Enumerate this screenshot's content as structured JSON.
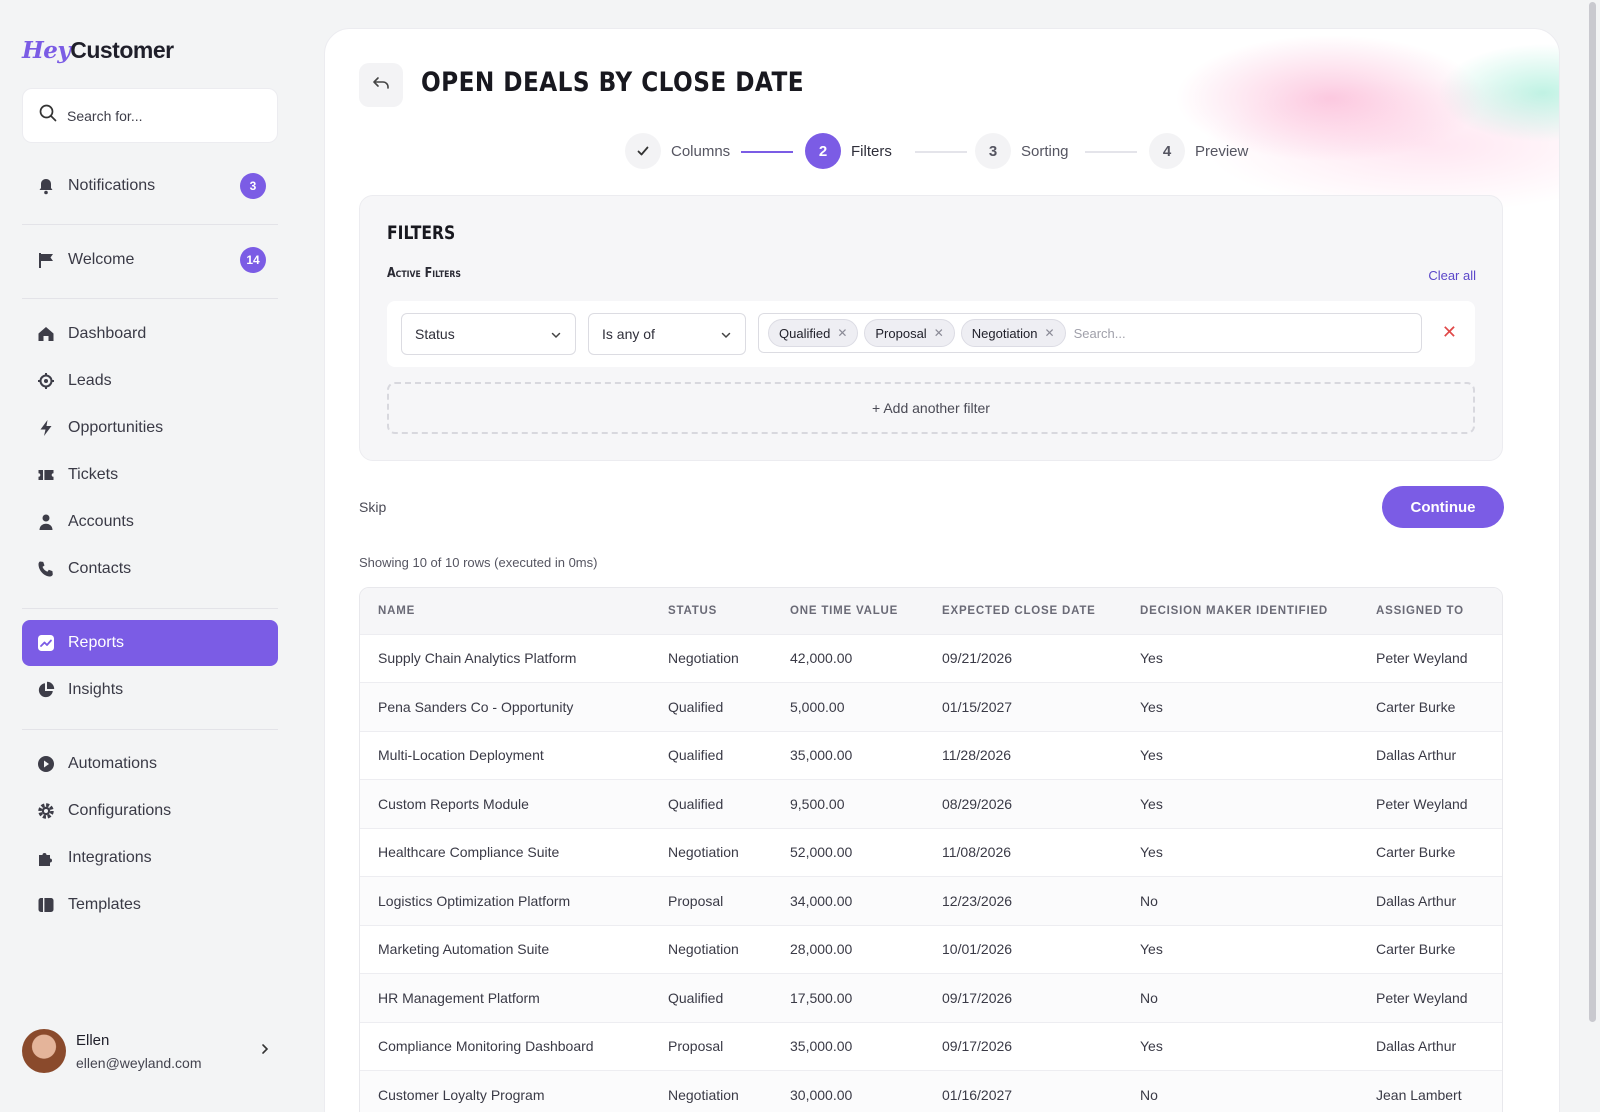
{
  "brand": {
    "prefix": "Hey",
    "suffix": "Customer"
  },
  "search": {
    "placeholder": "Search for..."
  },
  "sidebar": {
    "notifications": {
      "label": "Notifications",
      "badge": "3"
    },
    "welcome": {
      "label": "Welcome",
      "badge": "14"
    },
    "items": [
      {
        "label": "Dashboard",
        "icon": "home-icon"
      },
      {
        "label": "Leads",
        "icon": "target-icon"
      },
      {
        "label": "Opportunities",
        "icon": "bolt-icon"
      },
      {
        "label": "Tickets",
        "icon": "ticket-icon"
      },
      {
        "label": "Accounts",
        "icon": "person-icon"
      },
      {
        "label": "Contacts",
        "icon": "phone-icon"
      },
      {
        "label": "Reports",
        "icon": "chart-icon"
      },
      {
        "label": "Insights",
        "icon": "pie-icon"
      },
      {
        "label": "Automations",
        "icon": "play-icon"
      },
      {
        "label": "Configurations",
        "icon": "gear-icon"
      },
      {
        "label": "Integrations",
        "icon": "puzzle-icon"
      },
      {
        "label": "Templates",
        "icon": "template-icon"
      }
    ],
    "active": "Reports"
  },
  "user": {
    "name": "Ellen",
    "email": "ellen@weyland.com"
  },
  "page": {
    "title": "Open Deals by Close Date"
  },
  "stepper": {
    "steps": [
      {
        "number": "1",
        "label": "Columns",
        "state": "done"
      },
      {
        "number": "2",
        "label": "Filters",
        "state": "current"
      },
      {
        "number": "3",
        "label": "Sorting",
        "state": "upcoming"
      },
      {
        "number": "4",
        "label": "Preview",
        "state": "upcoming"
      }
    ]
  },
  "filters": {
    "title": "FILTERS",
    "active_label": "Active Filters",
    "clear_all": "Clear all",
    "field": "Status",
    "operator": "Is any of",
    "tags": [
      "Qualified",
      "Proposal",
      "Negotiation"
    ],
    "tag_search_placeholder": "Search...",
    "add_filter": "+ Add another filter"
  },
  "actions": {
    "skip": "Skip",
    "continue": "Continue"
  },
  "results": {
    "summary": "Showing 10 of 10 rows (executed in 0ms)"
  },
  "table": {
    "columns": [
      "NAME",
      "STATUS",
      "ONE TIME VALUE",
      "EXPECTED CLOSE DATE",
      "DECISION MAKER IDENTIFIED",
      "ASSIGNED TO"
    ],
    "rows": [
      [
        "Supply Chain Analytics Platform",
        "Negotiation",
        "42,000.00",
        "09/21/2026",
        "Yes",
        "Peter Weyland"
      ],
      [
        "Pena Sanders Co - Opportunity",
        "Qualified",
        "5,000.00",
        "01/15/2027",
        "Yes",
        "Carter Burke"
      ],
      [
        "Multi-Location Deployment",
        "Qualified",
        "35,000.00",
        "11/28/2026",
        "Yes",
        "Dallas Arthur"
      ],
      [
        "Custom Reports Module",
        "Qualified",
        "9,500.00",
        "08/29/2026",
        "Yes",
        "Peter Weyland"
      ],
      [
        "Healthcare Compliance Suite",
        "Negotiation",
        "52,000.00",
        "11/08/2026",
        "Yes",
        "Carter Burke"
      ],
      [
        "Logistics Optimization Platform",
        "Proposal",
        "34,000.00",
        "12/23/2026",
        "No",
        "Dallas Arthur"
      ],
      [
        "Marketing Automation Suite",
        "Negotiation",
        "28,000.00",
        "10/01/2026",
        "Yes",
        "Carter Burke"
      ],
      [
        "HR Management Platform",
        "Qualified",
        "17,500.00",
        "09/17/2026",
        "No",
        "Peter Weyland"
      ],
      [
        "Compliance Monitoring Dashboard",
        "Proposal",
        "35,000.00",
        "09/17/2026",
        "Yes",
        "Dallas Arthur"
      ],
      [
        "Customer Loyalty Program",
        "Negotiation",
        "30,000.00",
        "01/16/2027",
        "No",
        "Jean Lambert"
      ]
    ]
  },
  "colors": {
    "accent": "#7b5ce5",
    "danger": "#e04848",
    "link": "#5b47c9"
  }
}
